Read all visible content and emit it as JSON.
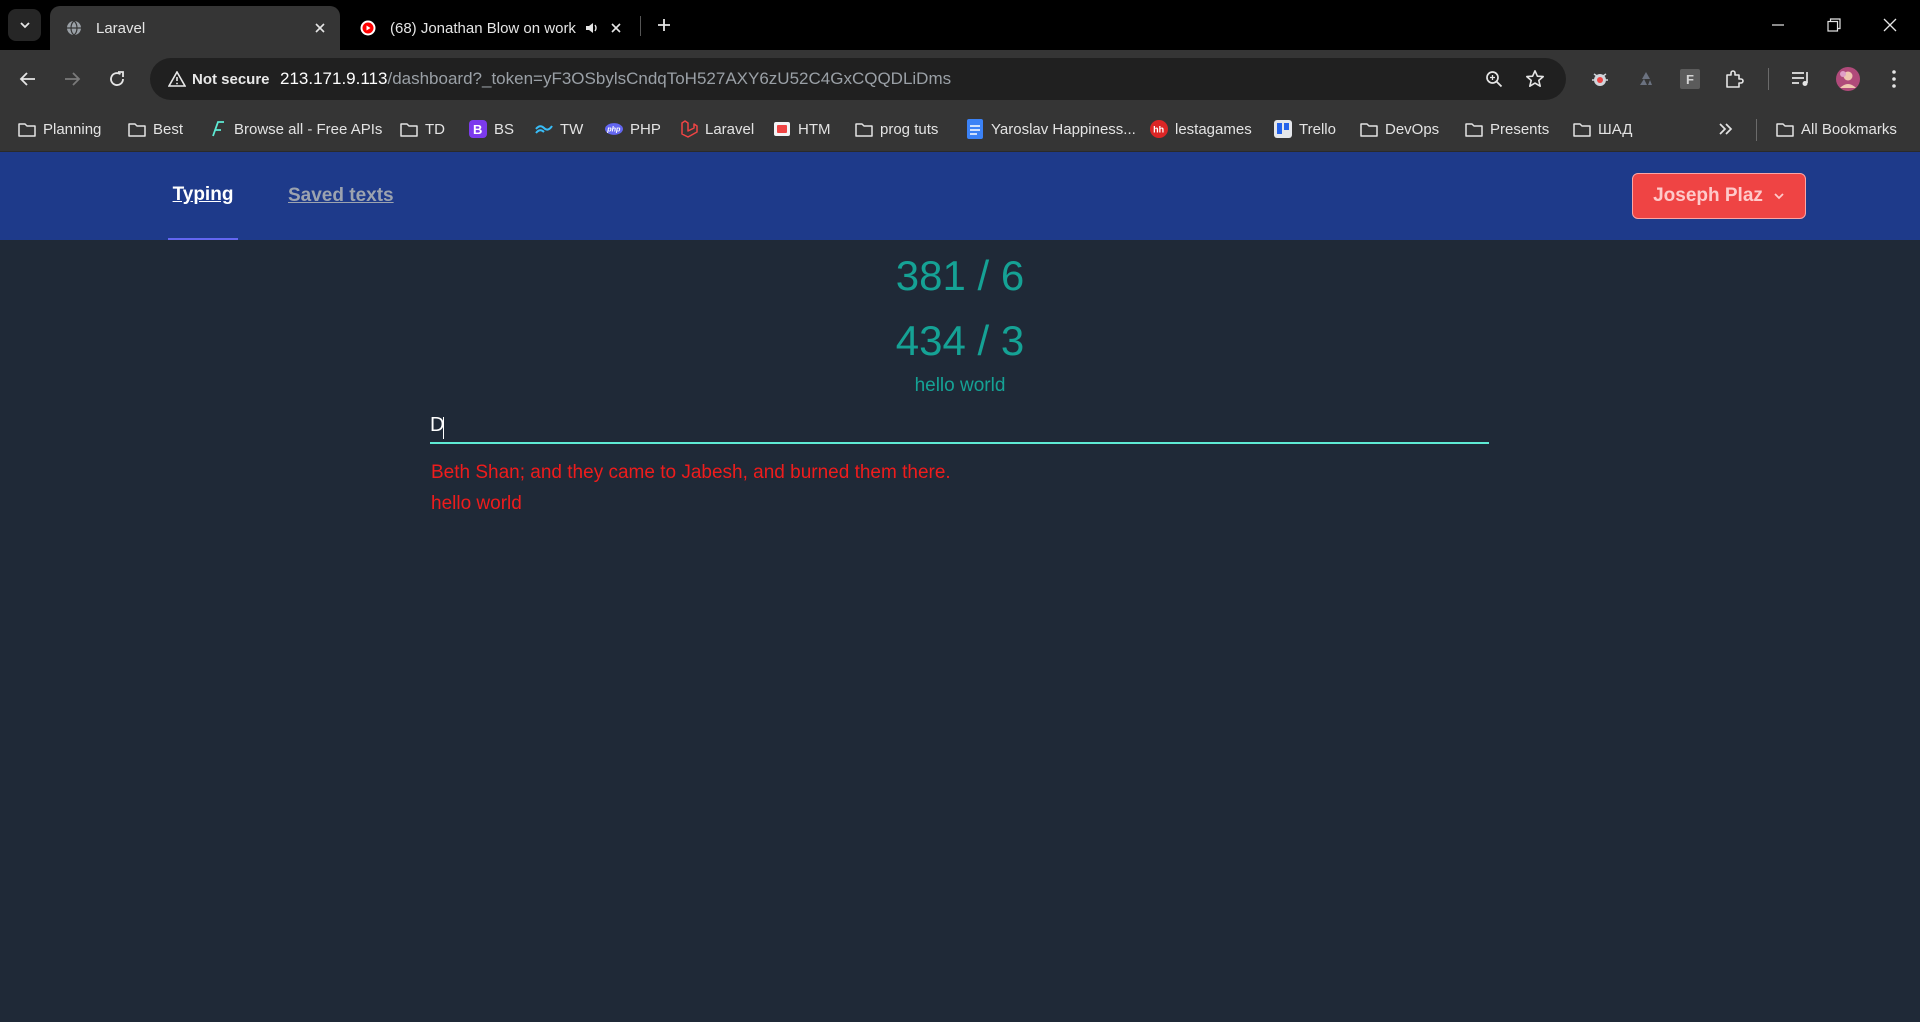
{
  "browser": {
    "tabs": [
      {
        "title": "Laravel",
        "active": true
      },
      {
        "title": "(68) Jonathan Blow on work",
        "active": false
      }
    ],
    "security_label": "Not secure",
    "url_host": "213.171.9.113",
    "url_path": "/dashboard?_token=yF3OSbylsCndqToH527AXY6zU52C4GxCQQDLiDms",
    "bookmarks": [
      {
        "label": "Planning",
        "icon": "folder-icon"
      },
      {
        "label": "Best",
        "icon": "folder-icon"
      },
      {
        "label": "Browse all - Free APIs",
        "icon": "api-icon"
      },
      {
        "label": "TD",
        "icon": "folder-icon"
      },
      {
        "label": "BS",
        "icon": "bootstrap-icon"
      },
      {
        "label": "TW",
        "icon": "tailwind-icon"
      },
      {
        "label": "PHP",
        "icon": "php-icon"
      },
      {
        "label": "Laravel",
        "icon": "laravel-icon"
      },
      {
        "label": "HTM",
        "icon": "html-icon"
      },
      {
        "label": "prog tuts",
        "icon": "folder-icon"
      },
      {
        "label": "Yaroslav Happiness...",
        "icon": "docs-icon"
      },
      {
        "label": "lestagames",
        "icon": "hh-icon"
      },
      {
        "label": "Trello",
        "icon": "trello-icon"
      },
      {
        "label": "DevOps",
        "icon": "folder-icon"
      },
      {
        "label": "Presents",
        "icon": "folder-icon"
      },
      {
        "label": "ШАД",
        "icon": "folder-icon"
      }
    ],
    "all_bookmarks_label": "All Bookmarks"
  },
  "nav": {
    "typing_label": "Typing",
    "saved_label": "Saved texts",
    "user_label": "Joseph Plaz"
  },
  "main": {
    "stat1": "381 / 6",
    "stat2": "434 / 3",
    "hint": "hello world",
    "input_value": "D",
    "lines": [
      "Beth Shan; and they came to Jabesh, and burned them there.",
      "hello world"
    ]
  },
  "colors": {
    "page_bg": "#1f2937",
    "nav_bg": "#1e3a8a",
    "accent_teal": "#14b8a6",
    "error_red": "#ef1c1c",
    "user_button": "#ef4444"
  }
}
